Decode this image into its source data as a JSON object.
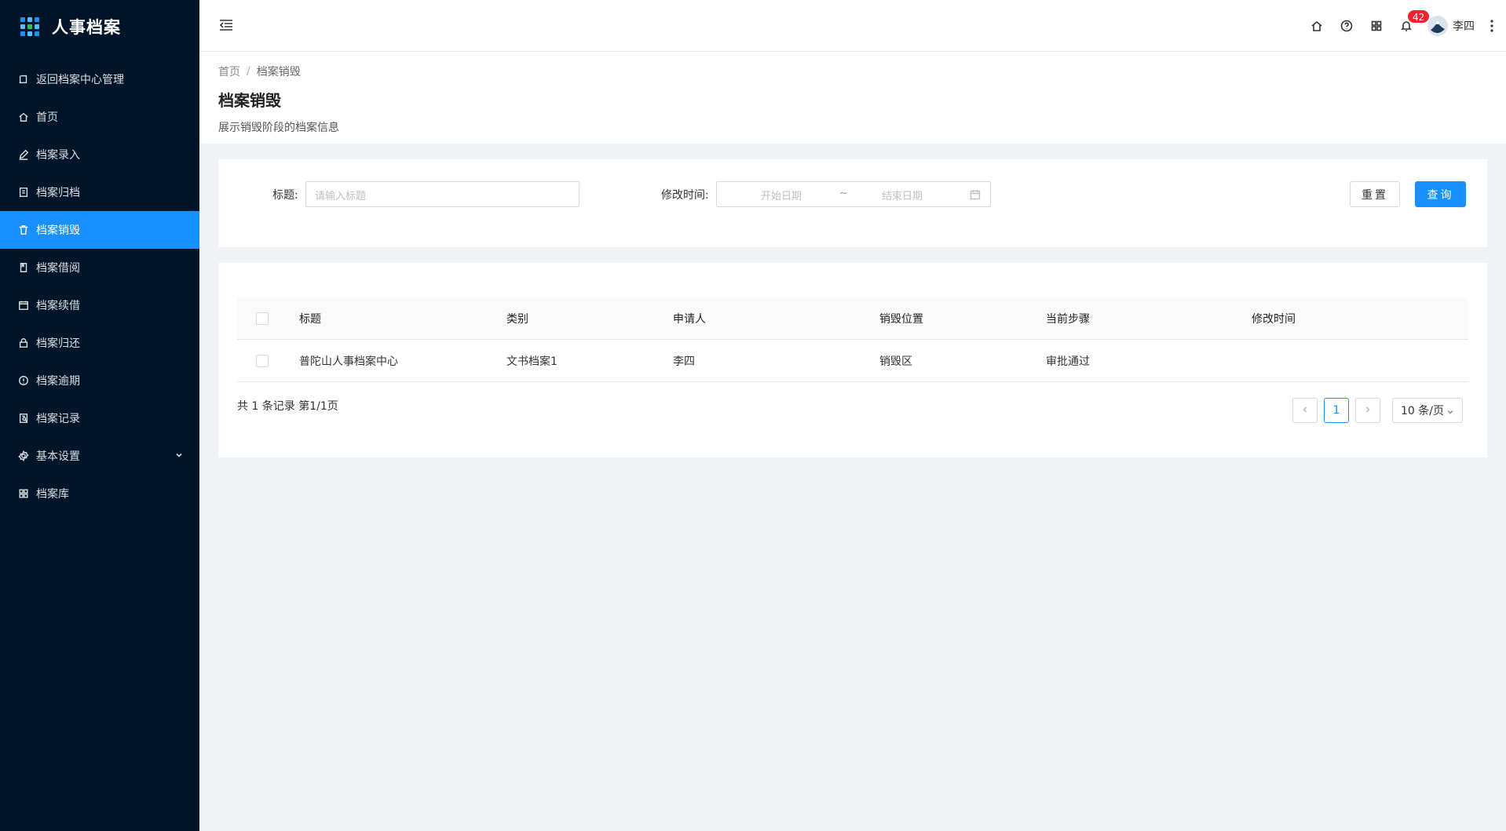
{
  "app": {
    "title": "人事档案"
  },
  "sidebar": {
    "items": [
      {
        "label": "返回档案中心管理",
        "icon": "back-icon"
      },
      {
        "label": "首页",
        "icon": "home-icon"
      },
      {
        "label": "档案录入",
        "icon": "edit-icon"
      },
      {
        "label": "档案归档",
        "icon": "file-icon"
      },
      {
        "label": "档案销毁",
        "icon": "trash-icon",
        "active": true
      },
      {
        "label": "档案借阅",
        "icon": "book-icon"
      },
      {
        "label": "档案续借",
        "icon": "calendar-icon"
      },
      {
        "label": "档案归还",
        "icon": "lock-icon"
      },
      {
        "label": "档案逾期",
        "icon": "info-icon"
      },
      {
        "label": "档案记录",
        "icon": "record-icon"
      },
      {
        "label": "基本设置",
        "icon": "gear-icon"
      },
      {
        "label": "档案库",
        "icon": "grid-icon"
      }
    ]
  },
  "header": {
    "notification_count": "42",
    "username": "李四"
  },
  "breadcrumb": {
    "home": "首页",
    "sep": "/",
    "current": "档案销毁"
  },
  "page": {
    "title": "档案销毁",
    "description": "展示销毁阶段的档案信息"
  },
  "search": {
    "title_label": "标题:",
    "title_placeholder": "请输入标题",
    "time_label": "修改时间:",
    "start_placeholder": "开始日期",
    "range_sep": "~",
    "end_placeholder": "结束日期",
    "reset_label": "重置",
    "query_label": "查询"
  },
  "table": {
    "columns": [
      "标题",
      "类别",
      "申请人",
      "销毁位置",
      "当前步骤",
      "修改时间"
    ],
    "rows": [
      [
        "普陀山人事档案中心",
        "文书档案1",
        "李四",
        "销毁区",
        "审批通过",
        ""
      ]
    ]
  },
  "pagination": {
    "total_text": "共 1 条记录 第1/1页",
    "current_page": "1",
    "page_size": "10 条/页"
  },
  "colors": {
    "primary": "#1890ff",
    "sidebar_bg": "#001529",
    "badge": "#f5222d"
  }
}
